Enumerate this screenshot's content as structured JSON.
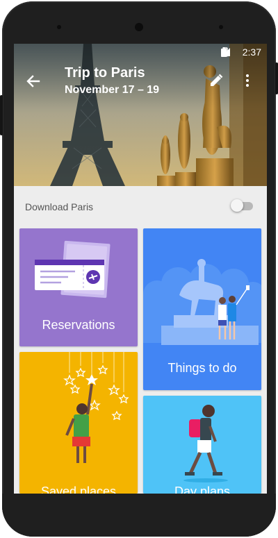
{
  "status_bar": {
    "time": "2:37",
    "icons": [
      "vibrate-icon",
      "bluetooth-icon",
      "lte-signal-icon",
      "battery-icon"
    ]
  },
  "header": {
    "title": "Trip to Paris",
    "dates": "November 17 – 19",
    "icons": {
      "back": "back-arrow-icon",
      "edit": "pencil-icon",
      "more": "more-vert-icon"
    }
  },
  "download": {
    "label": "Download Paris",
    "toggle_on": false
  },
  "tiles": {
    "reservations": {
      "label": "Reservations",
      "color": "#9575cd"
    },
    "things_to_do": {
      "label": "Things to do",
      "color": "#4285f4"
    },
    "saved_places": {
      "label": "Saved places",
      "color": "#f4b400"
    },
    "day_plans": {
      "label": "Day plans",
      "color": "#4fc3f7"
    }
  }
}
